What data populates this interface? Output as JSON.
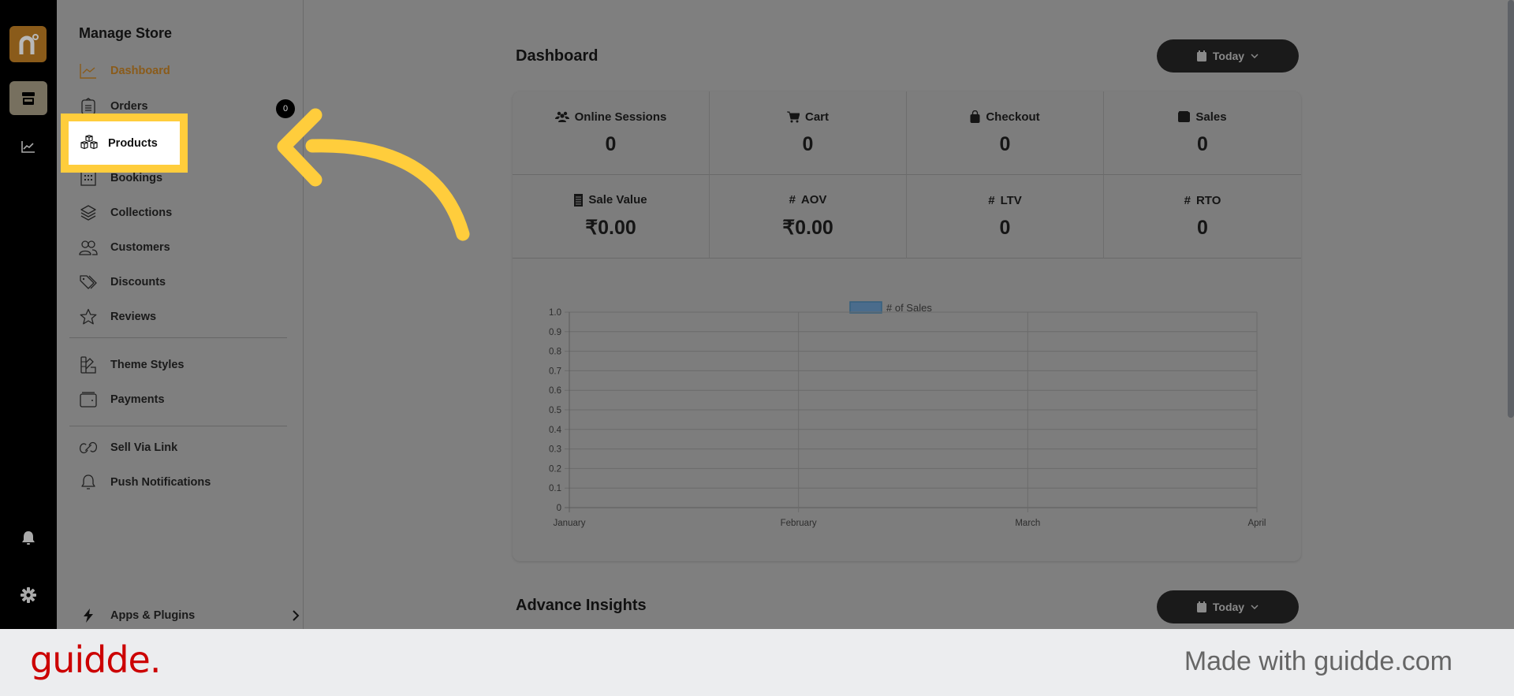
{
  "rail": {
    "icons": [
      "app-logo",
      "store-icon",
      "analytics-icon",
      "bell-icon",
      "gear-icon"
    ]
  },
  "sidebar": {
    "title": "Manage Store",
    "items": [
      {
        "label": "Dashboard",
        "icon": "chart-line-icon",
        "active": true
      },
      {
        "label": "Orders",
        "icon": "clipboard-icon",
        "badge": "0"
      },
      {
        "label": "Products",
        "icon": "boxes-icon",
        "highlighted": true
      },
      {
        "label": "Bookings",
        "icon": "calendar-grid-icon"
      },
      {
        "label": "Collections",
        "icon": "layers-icon"
      },
      {
        "label": "Customers",
        "icon": "users-icon"
      },
      {
        "label": "Discounts",
        "icon": "tag-icon"
      },
      {
        "label": "Reviews",
        "icon": "star-icon"
      },
      {
        "label": "Theme Styles",
        "icon": "swatch-icon"
      },
      {
        "label": "Payments",
        "icon": "wallet-icon"
      },
      {
        "label": "Sell Via Link",
        "icon": "link-icon"
      },
      {
        "label": "Push Notifications",
        "icon": "bell-outline-icon"
      }
    ],
    "apps": {
      "label": "Apps & Plugins",
      "icon": "bolt-icon"
    }
  },
  "main": {
    "title": "Dashboard",
    "date_filter": "Today",
    "stats": [
      {
        "label": "Online Sessions",
        "value": "0",
        "icon": "users-solid-icon"
      },
      {
        "label": "Cart",
        "value": "0",
        "icon": "cart-icon"
      },
      {
        "label": "Checkout",
        "value": "0",
        "icon": "bag-icon"
      },
      {
        "label": "Sales",
        "value": "0",
        "icon": "wallet-solid-icon"
      },
      {
        "label": "Sale Value",
        "value": "₹0.00",
        "icon": "receipt-icon"
      },
      {
        "label": "AOV",
        "value": "₹0.00",
        "icon": "hash-icon"
      },
      {
        "label": "LTV",
        "value": "0",
        "icon": "hash-icon"
      },
      {
        "label": "RTO",
        "value": "0",
        "icon": "hash-icon"
      }
    ],
    "insights_title": "Advance Insights",
    "insights_date_filter": "Today"
  },
  "chart_data": {
    "type": "bar",
    "title": "",
    "categories": [
      "January",
      "February",
      "March",
      "April"
    ],
    "series": [
      {
        "name": "# of Sales",
        "values": [
          0,
          0,
          0,
          0
        ],
        "color": "#4a6c8c"
      }
    ],
    "xlabel": "",
    "ylabel": "",
    "ylim": [
      0,
      1.0
    ],
    "yticks": [
      "0",
      "0.1",
      "0.2",
      "0.3",
      "0.4",
      "0.5",
      "0.6",
      "0.7",
      "0.8",
      "0.9",
      "1.0"
    ],
    "grid": true,
    "legend": "top-center"
  },
  "footer": {
    "brand": "guidde.",
    "made_with": "Made with guidde.com"
  },
  "colors": {
    "accent": "#8a5b1a",
    "highlight": "#ffcd3c",
    "brand_red": "#cc0000"
  }
}
